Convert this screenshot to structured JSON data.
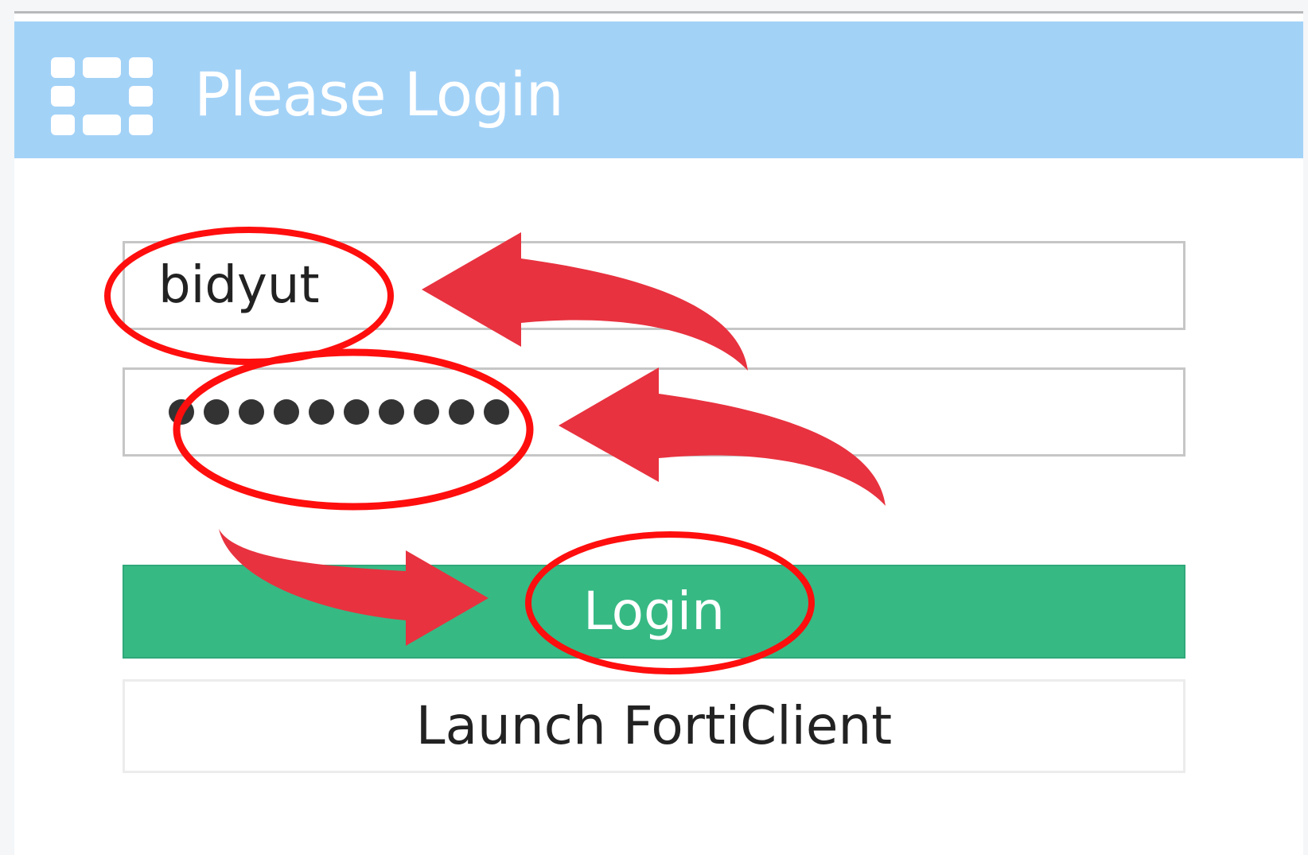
{
  "header": {
    "title": "Please Login",
    "logo_icon": "fortinet-logo-icon",
    "background_color": "#a3d2f7"
  },
  "login_form": {
    "username_value": "bidyut",
    "password_masked": "●●●●●●●●●●",
    "password_length": 10,
    "login_button_label": "Login",
    "login_button_color": "#37b984",
    "launch_forticlient_label": "Launch FortiClient"
  },
  "annotations": {
    "color": "#e8323f",
    "highlighted": [
      "username",
      "password",
      "login-button"
    ]
  }
}
